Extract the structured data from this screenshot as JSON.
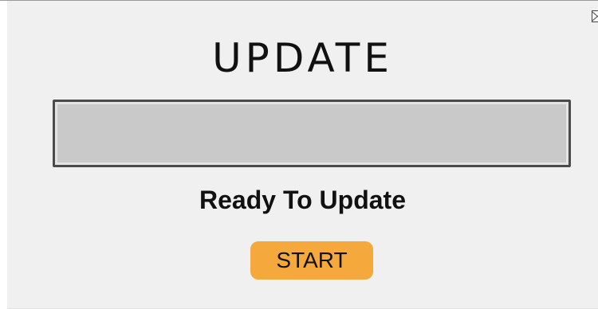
{
  "header": {
    "title": "UPDATE"
  },
  "progress": {
    "value": 0
  },
  "status": {
    "text": "Ready To Update"
  },
  "actions": {
    "start_label": "START"
  },
  "colors": {
    "window_bg": "#f0f0f0",
    "track_bg": "#c9c9c9",
    "track_border": "#4a4a4a",
    "start_button": "#f5a83c",
    "text": "#111111"
  },
  "icons": {
    "close": "close-icon"
  }
}
